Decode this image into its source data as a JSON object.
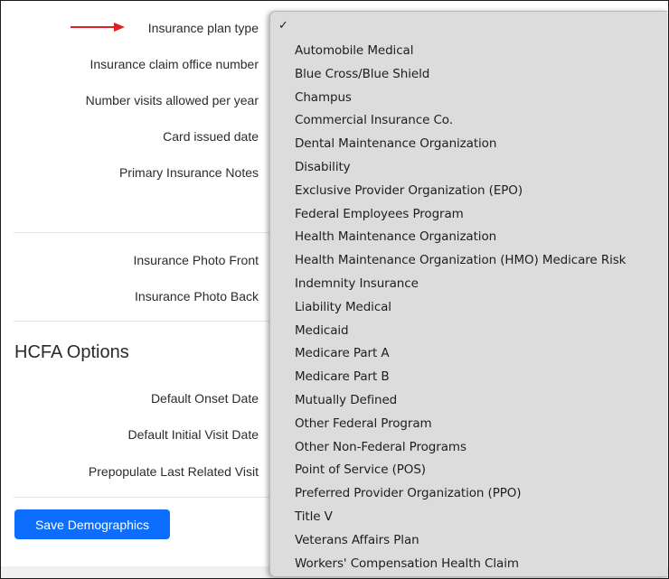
{
  "form": {
    "fields": [
      {
        "label": "Insurance plan type"
      },
      {
        "label": "Insurance claim office number"
      },
      {
        "label": "Number visits allowed per year"
      },
      {
        "label": "Card issued date"
      },
      {
        "label": "Primary Insurance Notes"
      },
      {
        "label": "Insurance Photo Front"
      },
      {
        "label": "Insurance Photo Back"
      }
    ],
    "hcfa_title": "HCFA Options",
    "hcfa_fields": [
      {
        "label": "Default Onset Date"
      },
      {
        "label": "Default Initial Visit Date"
      },
      {
        "label": "Prepopulate Last Related Visit"
      }
    ],
    "save_label": "Save Demographics"
  },
  "colors": {
    "arrow": "#e02020",
    "button": "#0d6efd"
  },
  "dropdown": {
    "checkmark": "✓",
    "options": [
      "Automobile Medical",
      "Blue Cross/Blue Shield",
      "Champus",
      "Commercial Insurance Co.",
      "Dental Maintenance Organization",
      "Disability",
      "Exclusive Provider Organization (EPO)",
      "Federal Employees Program",
      "Health Maintenance Organization",
      "Health Maintenance Organization (HMO) Medicare Risk",
      "Indemnity Insurance",
      "Liability Medical",
      "Medicaid",
      "Medicare Part A",
      "Medicare Part B",
      "Mutually Defined",
      "Other Federal Program",
      "Other Non-Federal Programs",
      "Point of Service (POS)",
      "Preferred Provider Organization (PPO)",
      "Title V",
      "Veterans Affairs Plan",
      "Workers' Compensation Health Claim"
    ]
  }
}
